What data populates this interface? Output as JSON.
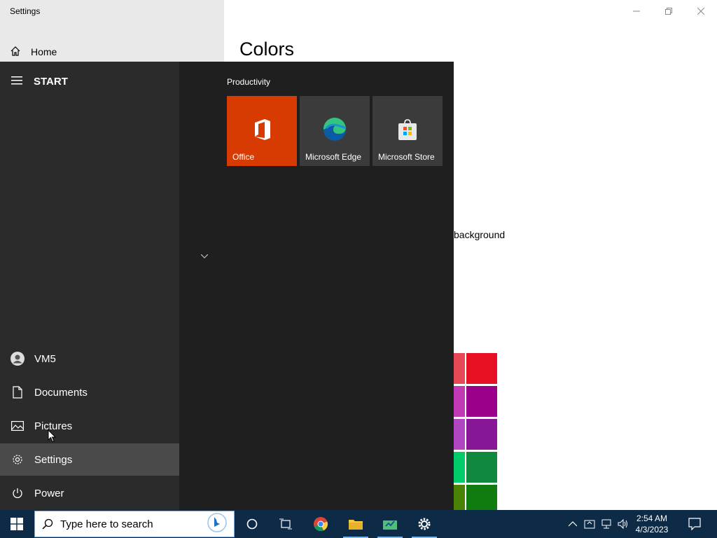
{
  "settings": {
    "window_title": "Settings",
    "home_label": "Home",
    "page_title": "Colors",
    "background_text": "background",
    "swatch_colors": [
      "#e74856",
      "#e81123",
      "#c239b3",
      "#9a0089",
      "#b146c2",
      "#881798",
      "#00cc6a",
      "#10893e",
      "#498205",
      "#107c10"
    ]
  },
  "start_menu": {
    "header": "START",
    "user_name": "VM5",
    "items": [
      {
        "label": "Documents"
      },
      {
        "label": "Pictures"
      },
      {
        "label": "Settings"
      },
      {
        "label": "Power"
      }
    ],
    "group_label": "Productivity",
    "tiles": [
      {
        "label": "Office",
        "color": "#d83b01"
      },
      {
        "label": "Microsoft Edge",
        "color": "#3b3b3b"
      },
      {
        "label": "Microsoft Store",
        "color": "#3b3b3b"
      }
    ]
  },
  "taskbar": {
    "search_placeholder": "Type here to search",
    "time": "2:54 AM",
    "date": "4/3/2023"
  }
}
